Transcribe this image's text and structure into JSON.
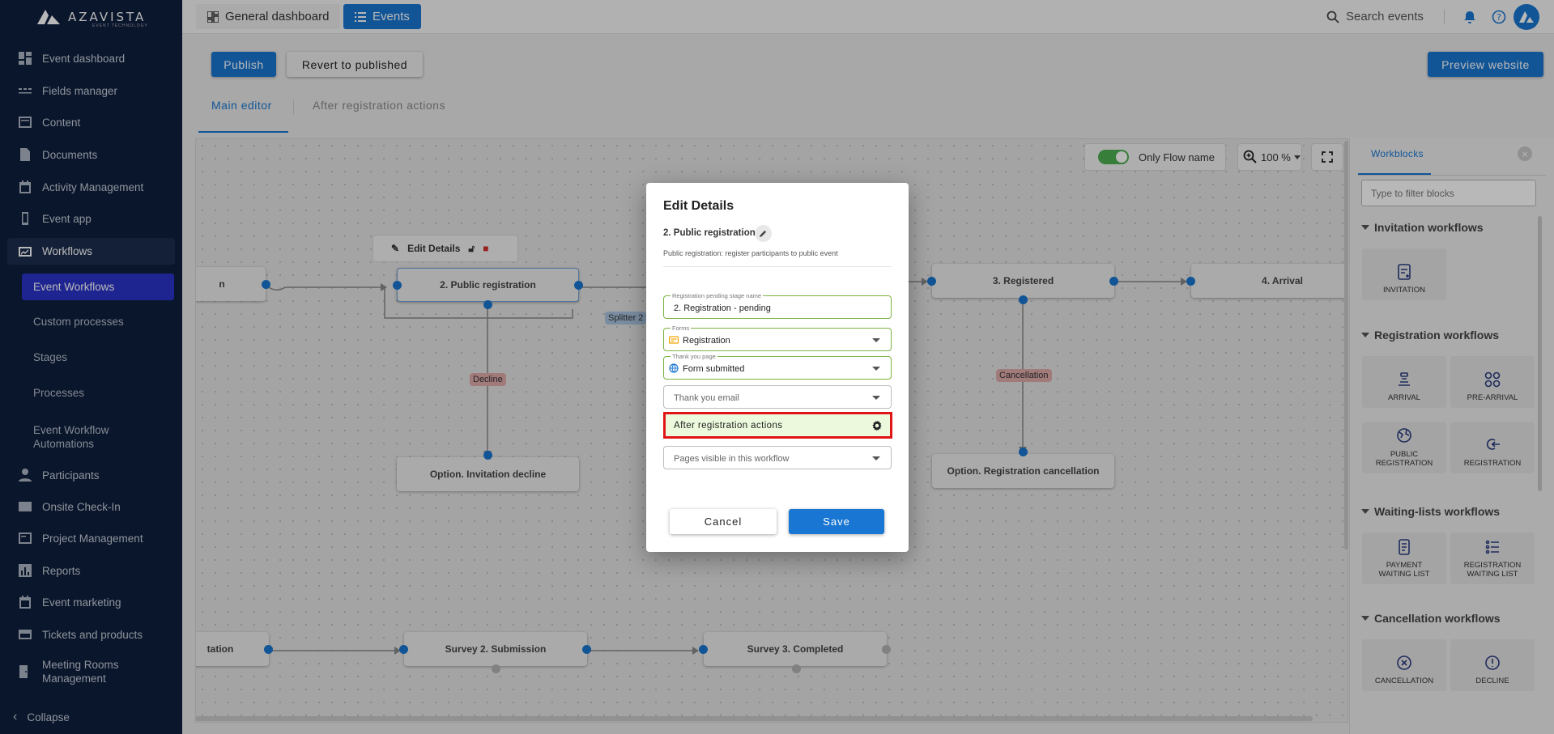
{
  "brand": {
    "name": "AZAVISTA",
    "tagline": "EVENT TECHNOLOGY"
  },
  "sidebar": {
    "items": [
      {
        "label": "Event dashboard",
        "icon": "dashboard-icon"
      },
      {
        "label": "Fields manager",
        "icon": "fields-icon"
      },
      {
        "label": "Content",
        "icon": "content-icon"
      },
      {
        "label": "Documents",
        "icon": "document-icon"
      },
      {
        "label": "Activity Management",
        "icon": "calendar-icon"
      },
      {
        "label": "Event app",
        "icon": "phone-icon"
      },
      {
        "label": "Workflows",
        "icon": "workflow-icon"
      },
      {
        "label": "Participants",
        "icon": "person-icon"
      },
      {
        "label": "Onsite Check-In",
        "icon": "mail-icon"
      },
      {
        "label": "Project Management",
        "icon": "project-icon"
      },
      {
        "label": "Reports",
        "icon": "reports-icon"
      },
      {
        "label": "Event marketing",
        "icon": "marketing-icon"
      },
      {
        "label": "Tickets and products",
        "icon": "ticket-icon"
      },
      {
        "label": "Meeting Rooms\nManagement",
        "icon": "meeting-room-icon"
      }
    ],
    "workflow_sub": [
      "Event Workflows",
      "Custom processes",
      "Stages",
      "Processes",
      "Event Workflow\nAutomations"
    ],
    "collapse_label": "Collapse"
  },
  "topbar": {
    "general_dashboard": "General dashboard",
    "events": "Events",
    "search_placeholder": "Search events"
  },
  "toolbar": {
    "publish": "Publish",
    "revert": "Revert to published",
    "preview": "Preview website"
  },
  "tabs": [
    "Main editor",
    "After registration actions"
  ],
  "canvas": {
    "only_flow_name": "Only Flow name",
    "zoom": "100 %",
    "edit_details": "Edit Details",
    "nodes": {
      "left_partial": "n",
      "public_registration": "2. Public registration",
      "registered": "3. Registered",
      "arrival": "4. Arrival",
      "invitation_decline": "Option. Invitation decline",
      "registration_cancellation": "Option. Registration cancellation",
      "tation": "tation",
      "survey2": "Survey 2. Submission",
      "survey3": "Survey 3. Completed"
    },
    "tags": {
      "splitter": "Splitter 2",
      "decline": "Decline",
      "cancellation": "Cancellation"
    }
  },
  "workblocks": {
    "tab": "Workblocks",
    "filter_placeholder": "Type to filter blocks",
    "sections": [
      {
        "title": "Invitation workflows",
        "blocks": [
          "INVITATION"
        ]
      },
      {
        "title": "Registration workflows",
        "blocks": [
          "ARRIVAL",
          "PRE-ARRIVAL",
          "PUBLIC REGISTRATION",
          "REGISTRATION"
        ]
      },
      {
        "title": "Waiting-lists workflows",
        "blocks": [
          "PAYMENT WAITING LIST",
          "REGISTRATION WAITING LIST"
        ]
      },
      {
        "title": "Cancellation workflows",
        "blocks": [
          "CANCELLATION",
          "DECLINE"
        ]
      }
    ]
  },
  "modal": {
    "title": "Edit Details",
    "stage": "2. Public registration",
    "description": "Public registration: register participants to public event",
    "pending_label": "Registration pending stage name",
    "pending_value": "2. Registration - pending",
    "forms_label": "Forms",
    "forms_value": "Registration",
    "thankyou_label": "Thank you page",
    "thankyou_value": "Form submitted",
    "email_placeholder": "Thank you email",
    "after_reg": "After registration actions",
    "pages_placeholder": "Pages visible in this workflow",
    "cancel": "Cancel",
    "save": "Save"
  },
  "colors": {
    "accent": "#1976d2",
    "sidebar": "#0e1f3d",
    "highlight": "#e01515",
    "success_bg": "#ecf9dc"
  }
}
